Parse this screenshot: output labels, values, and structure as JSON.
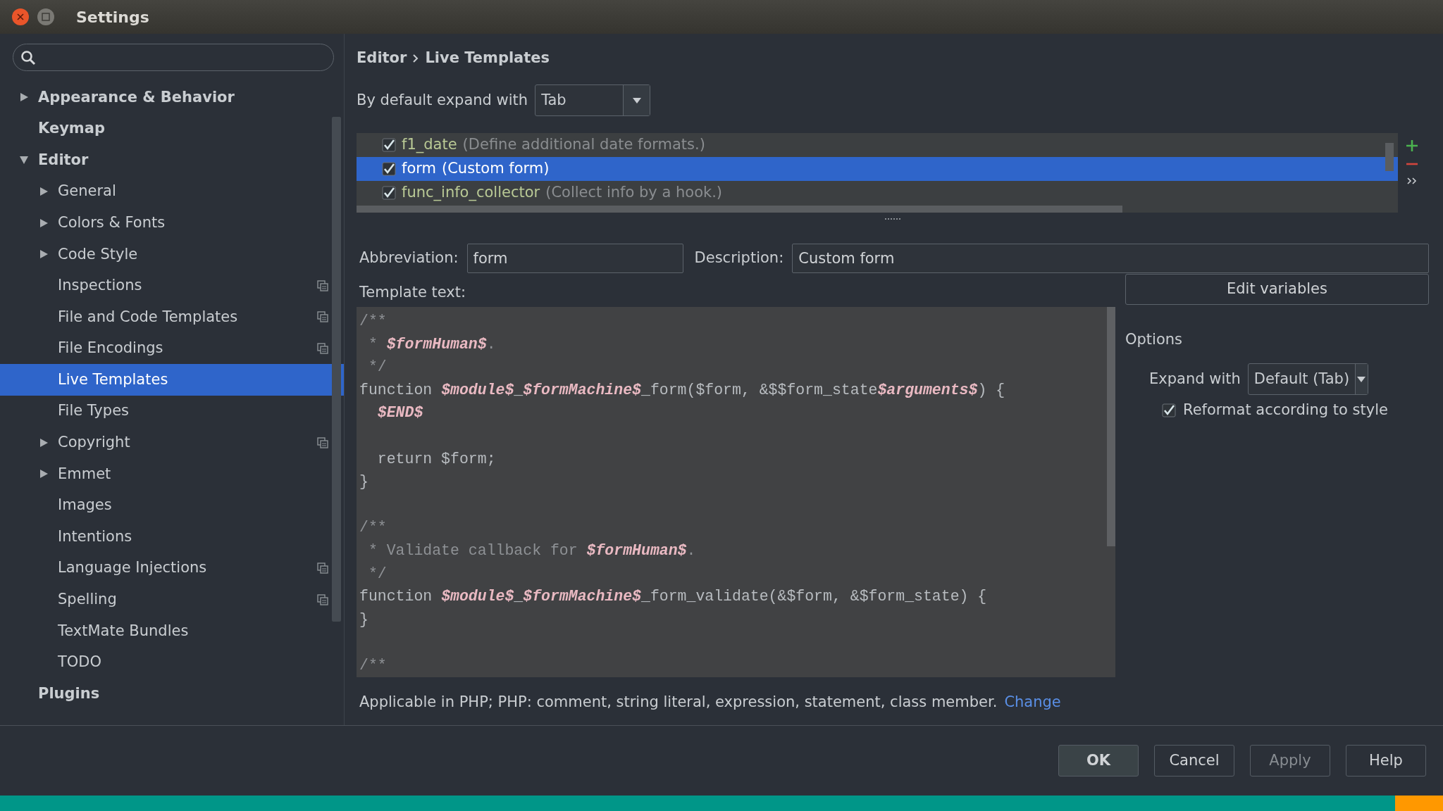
{
  "window": {
    "title": "Settings"
  },
  "sidebar": {
    "items": [
      {
        "label": "Appearance & Behavior",
        "expandable": true,
        "expanded": false,
        "selected": false,
        "per_project": false
      },
      {
        "label": "Keymap",
        "expandable": false,
        "expanded": false,
        "selected": false,
        "per_project": false
      },
      {
        "label": "Editor",
        "expandable": true,
        "expanded": true,
        "selected": false,
        "per_project": false,
        "children": [
          {
            "label": "General",
            "expandable": true,
            "expanded": false,
            "selected": false,
            "per_project": false
          },
          {
            "label": "Colors & Fonts",
            "expandable": true,
            "expanded": false,
            "selected": false,
            "per_project": false
          },
          {
            "label": "Code Style",
            "expandable": true,
            "expanded": false,
            "selected": false,
            "per_project": false
          },
          {
            "label": "Inspections",
            "expandable": false,
            "expanded": false,
            "selected": false,
            "per_project": true
          },
          {
            "label": "File and Code Templates",
            "expandable": false,
            "expanded": false,
            "selected": false,
            "per_project": true
          },
          {
            "label": "File Encodings",
            "expandable": false,
            "expanded": false,
            "selected": false,
            "per_project": true
          },
          {
            "label": "Live Templates",
            "expandable": false,
            "expanded": false,
            "selected": true,
            "per_project": false
          },
          {
            "label": "File Types",
            "expandable": false,
            "expanded": false,
            "selected": false,
            "per_project": false
          },
          {
            "label": "Copyright",
            "expandable": true,
            "expanded": false,
            "selected": false,
            "per_project": true
          },
          {
            "label": "Emmet",
            "expandable": true,
            "expanded": false,
            "selected": false,
            "per_project": false
          },
          {
            "label": "Images",
            "expandable": false,
            "expanded": false,
            "selected": false,
            "per_project": false
          },
          {
            "label": "Intentions",
            "expandable": false,
            "expanded": false,
            "selected": false,
            "per_project": false
          },
          {
            "label": "Language Injections",
            "expandable": false,
            "expanded": false,
            "selected": false,
            "per_project": true
          },
          {
            "label": "Spelling",
            "expandable": false,
            "expanded": false,
            "selected": false,
            "per_project": true
          },
          {
            "label": "TextMate Bundles",
            "expandable": false,
            "expanded": false,
            "selected": false,
            "per_project": false
          },
          {
            "label": "TODO",
            "expandable": false,
            "expanded": false,
            "selected": false,
            "per_project": false
          }
        ]
      },
      {
        "label": "Plugins",
        "expandable": false,
        "expanded": false,
        "selected": false,
        "per_project": false
      }
    ]
  },
  "breadcrumb": [
    "Editor",
    "Live Templates"
  ],
  "default_expand": {
    "label": "By default expand with",
    "value": "Tab"
  },
  "templates": [
    {
      "name": "f1_date",
      "description": "(Define additional date formats.)",
      "checked": true,
      "selected": false
    },
    {
      "name": "form",
      "description": "(Custom form)",
      "checked": true,
      "selected": true
    },
    {
      "name": "func_info_collector",
      "description": "(Collect info by a hook.)",
      "checked": true,
      "selected": false
    }
  ],
  "abbreviation": {
    "label": "Abbreviation:",
    "value": "form"
  },
  "description": {
    "label": "Description:",
    "value": "Custom form"
  },
  "template_text": {
    "label": "Template text:",
    "lines": [
      {
        "kind": "text",
        "segments": [
          {
            "kind": "comment",
            "text": "/**"
          }
        ]
      },
      {
        "kind": "text",
        "segments": [
          {
            "kind": "comment",
            "text": " * "
          },
          {
            "kind": "var",
            "text": "$formHuman$"
          },
          {
            "kind": "comment",
            "text": "."
          }
        ]
      },
      {
        "kind": "text",
        "segments": [
          {
            "kind": "comment",
            "text": " */"
          }
        ]
      },
      {
        "kind": "text",
        "segments": [
          {
            "kind": "code",
            "text": "function "
          },
          {
            "kind": "var",
            "text": "$module$"
          },
          {
            "kind": "code",
            "text": "_"
          },
          {
            "kind": "var",
            "text": "$formMachine$"
          },
          {
            "kind": "code",
            "text": "_form($form, &$$form_state"
          },
          {
            "kind": "var",
            "text": "$arguments$"
          },
          {
            "kind": "code",
            "text": ") {"
          }
        ]
      },
      {
        "kind": "text",
        "segments": [
          {
            "kind": "var",
            "text": "  $END$"
          }
        ]
      },
      {
        "kind": "blank"
      },
      {
        "kind": "text",
        "segments": [
          {
            "kind": "code",
            "text": "  return $form;"
          }
        ]
      },
      {
        "kind": "text",
        "segments": [
          {
            "kind": "code",
            "text": "}"
          }
        ]
      },
      {
        "kind": "blank"
      },
      {
        "kind": "text",
        "segments": [
          {
            "kind": "comment",
            "text": "/**"
          }
        ]
      },
      {
        "kind": "text",
        "segments": [
          {
            "kind": "comment",
            "text": " * Validate callback for "
          },
          {
            "kind": "var",
            "text": "$formHuman$"
          },
          {
            "kind": "comment",
            "text": "."
          }
        ]
      },
      {
        "kind": "text",
        "segments": [
          {
            "kind": "comment",
            "text": " */"
          }
        ]
      },
      {
        "kind": "text",
        "segments": [
          {
            "kind": "code",
            "text": "function "
          },
          {
            "kind": "var",
            "text": "$module$"
          },
          {
            "kind": "code",
            "text": "_"
          },
          {
            "kind": "var",
            "text": "$formMachine$"
          },
          {
            "kind": "code",
            "text": "_form_validate(&$form, &$form_state) {"
          }
        ]
      },
      {
        "kind": "text",
        "segments": [
          {
            "kind": "code",
            "text": "}"
          }
        ]
      },
      {
        "kind": "blank"
      },
      {
        "kind": "text",
        "segments": [
          {
            "kind": "comment",
            "text": "/**"
          }
        ]
      }
    ]
  },
  "edit_variables": "Edit variables",
  "options": {
    "title": "Options",
    "expand_label": "Expand with",
    "expand_value": "Default (Tab)",
    "reformat": {
      "label": "Reformat according to style",
      "checked": true
    }
  },
  "applicable": {
    "text": "Applicable in PHP; PHP: comment, string literal, expression, statement, class member.",
    "link": "Change"
  },
  "buttons": [
    {
      "label": "OK",
      "default": true,
      "disabled": false
    },
    {
      "label": "Cancel",
      "default": false,
      "disabled": false
    },
    {
      "label": "Apply",
      "default": false,
      "disabled": true
    },
    {
      "label": "Help",
      "default": false,
      "disabled": false
    }
  ]
}
